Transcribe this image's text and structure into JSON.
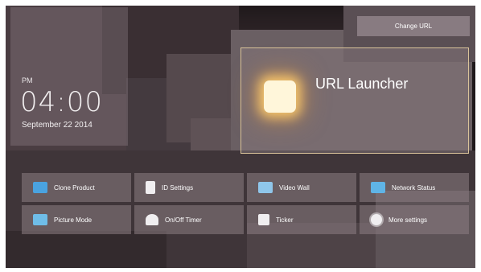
{
  "clock": {
    "ampm": "PM",
    "time": "04:00",
    "date": "September 22 2014"
  },
  "header": {
    "change_url_label": "Change URL"
  },
  "launcher": {
    "title": "URL Launcher"
  },
  "menu": [
    {
      "label": "Clone Product",
      "icon": "clone-icon"
    },
    {
      "label": "ID Settings",
      "icon": "id-settings-icon"
    },
    {
      "label": "Video Wall",
      "icon": "video-wall-icon"
    },
    {
      "label": "Network Status",
      "icon": "network-status-icon"
    },
    {
      "label": "Picture Mode",
      "icon": "picture-mode-icon"
    },
    {
      "label": "On/Off Timer",
      "icon": "timer-icon"
    },
    {
      "label": "Ticker",
      "icon": "ticker-icon"
    },
    {
      "label": "More settings",
      "icon": "gear-icon"
    }
  ]
}
